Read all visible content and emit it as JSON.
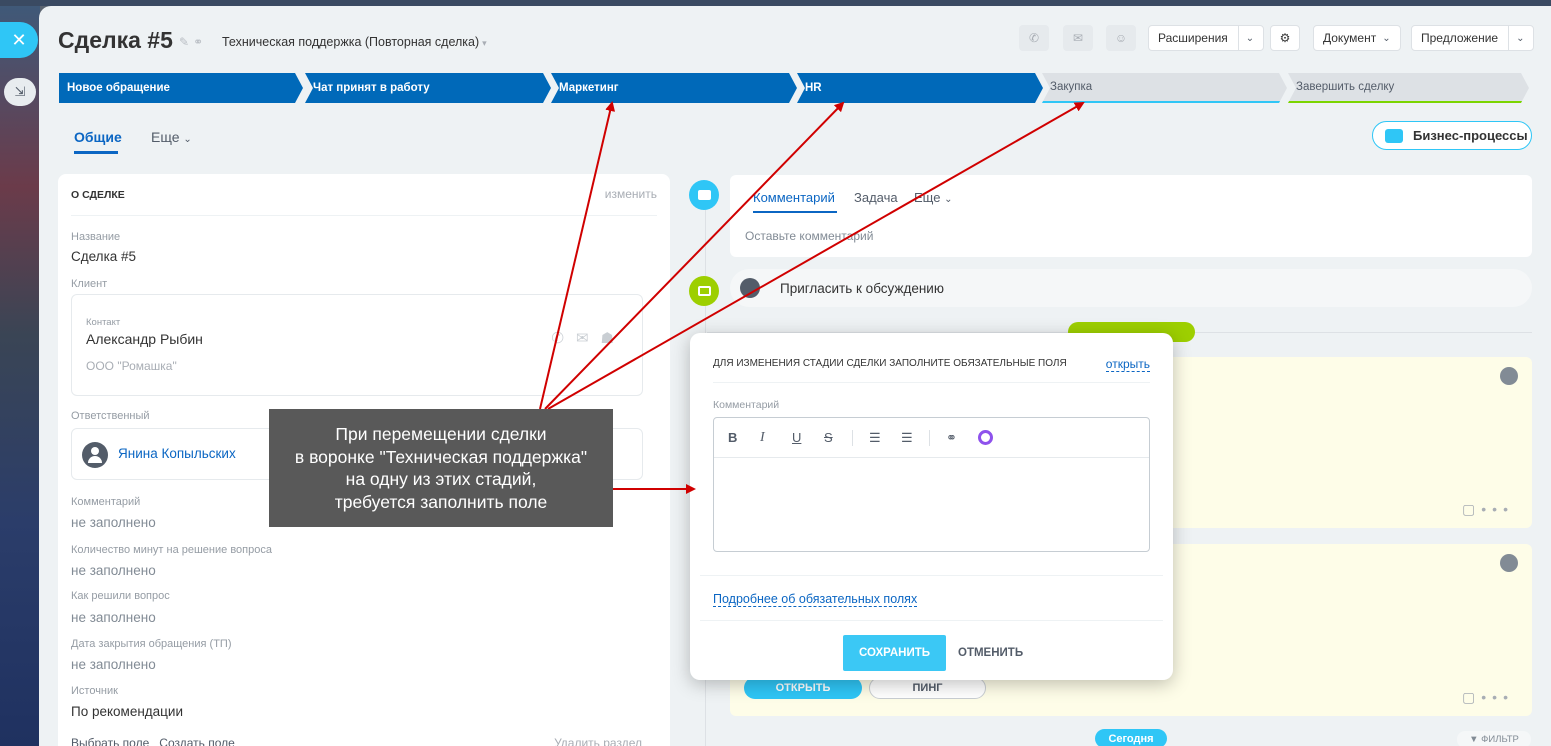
{
  "slider": {
    "close_icon": "close-icon",
    "minimize_icon": "minimize-icon"
  },
  "header": {
    "title": "Сделка #5",
    "funnel": "Техническая поддержка (Повторная сделка)",
    "extensions": "Расширения",
    "document": "Документ",
    "proposal": "Предложение"
  },
  "stages": [
    {
      "label": "Новое обращение",
      "state": "active"
    },
    {
      "label": "Чат принят в работу",
      "state": "active"
    },
    {
      "label": "Маркетинг",
      "state": "active"
    },
    {
      "label": "HR",
      "state": "active"
    },
    {
      "label": "Закупка",
      "state": "inactive"
    },
    {
      "label": "Завершить сделку",
      "state": "inactive"
    }
  ],
  "tabs": {
    "general": "Общие",
    "more": "Еще"
  },
  "business_processes": "Бизнес-процессы",
  "about": {
    "heading": "О СДЕЛКЕ",
    "edit": "изменить",
    "name_label": "Название",
    "name_value": "Сделка #5",
    "client_label": "Клиент",
    "contact_label": "Контакт",
    "contact_name": "Александр Рыбин",
    "contact_company": "ООО \"Ромашка\"",
    "responsible_label": "Ответственный",
    "responsible_name": "Янина Копыльских",
    "fields": [
      {
        "label": "Комментарий",
        "value": "не заполнено"
      },
      {
        "label": "Количество минут на решение вопроса",
        "value": "не заполнено"
      },
      {
        "label": "Как решили вопрос",
        "value": "не заполнено"
      },
      {
        "label": "Дата закрытия обращения (ТП)",
        "value": "не заполнено"
      }
    ],
    "source_label": "Источник",
    "source_value": "По рекомендации",
    "select_field": "Выбрать поле",
    "create_field": "Создать поле",
    "delete_section": "Удалить раздел"
  },
  "timeline": {
    "tab_comment": "Комментарий",
    "tab_task": "Задача",
    "tab_more": "Еще",
    "comment_placeholder": "Оставьте комментарий",
    "invite": "Пригласить к обсуждению",
    "open_button": "ОТКРЫТЬ",
    "ping_button": "ПИНГ",
    "today": "Сегодня",
    "filter": "ФИЛЬТР"
  },
  "popup": {
    "title": "ДЛЯ ИЗМЕНЕНИЯ СТАДИИ СДЕЛКИ ЗАПОЛНИТЕ ОБЯЗАТЕЛЬНЫЕ ПОЛЯ",
    "open_link": "открыть",
    "comment_label": "Комментарий",
    "toolbar": [
      "B",
      "I",
      "U",
      "S"
    ],
    "more_link": "Подробнее об обязательных полях",
    "save": "СОХРАНИТЬ",
    "cancel": "ОТМЕНИТЬ"
  },
  "callout": {
    "lines": [
      "При перемещении сделки",
      "в воронке \"Техническая поддержка\"",
      "на одну из этих стадий,",
      "требуется заполнить поле"
    ]
  },
  "colors": {
    "accent": "#0069b9",
    "primary_button": "#3bc8f5",
    "annotation_arrow": "#d00000",
    "callout_bg": "#595959"
  }
}
